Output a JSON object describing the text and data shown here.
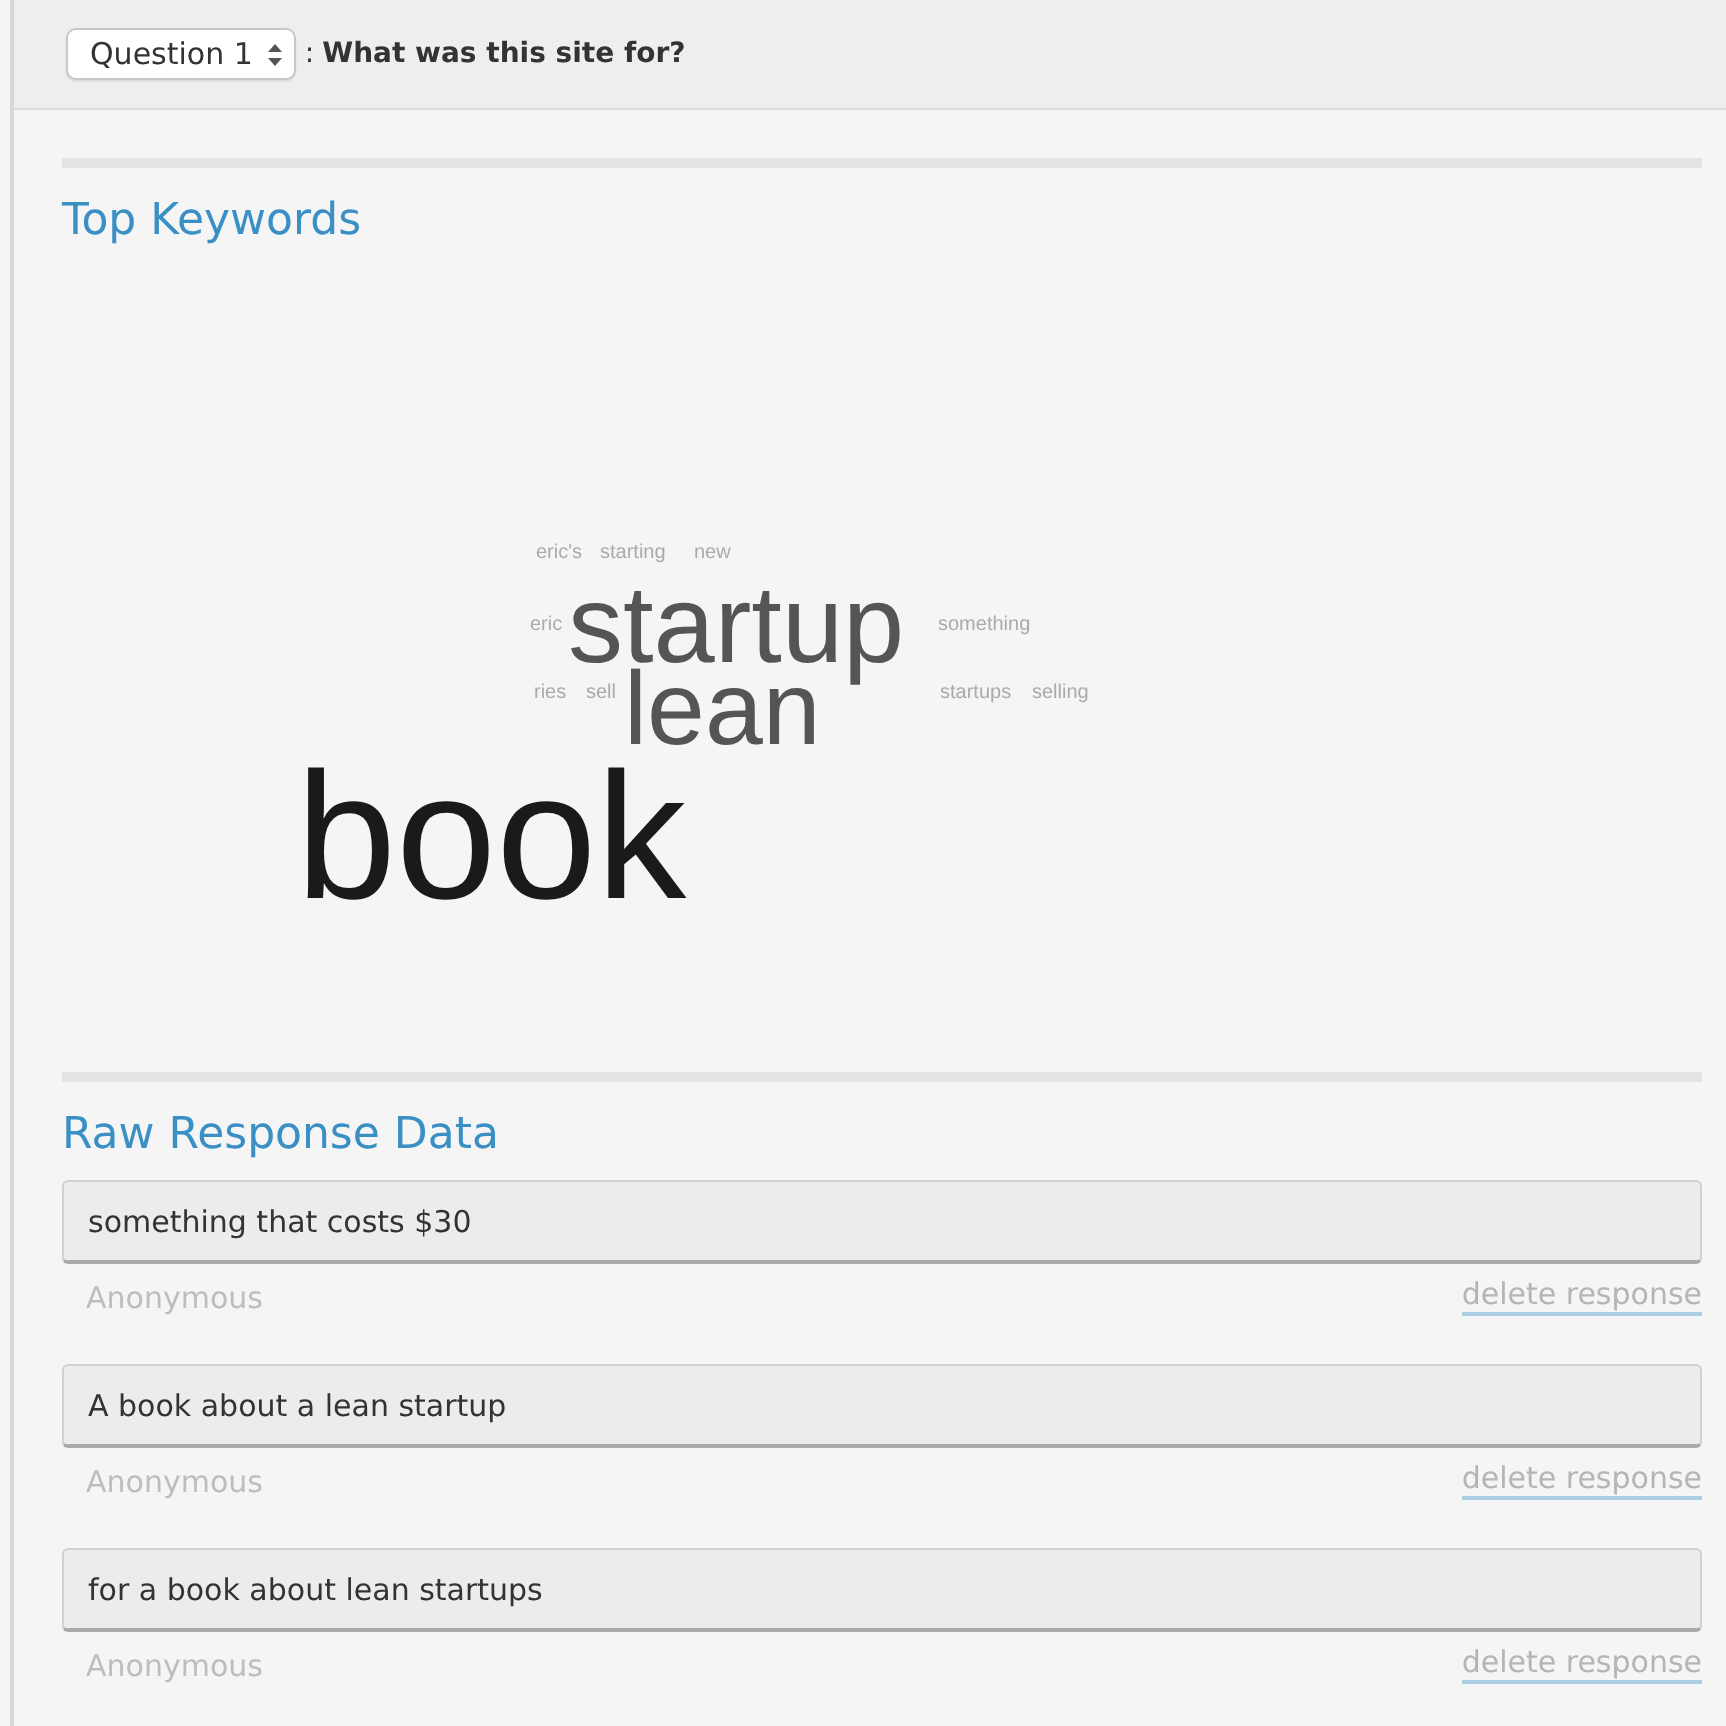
{
  "header": {
    "question_select": {
      "value": "Question 1"
    },
    "separator": ":",
    "question_text": "What was this site for?"
  },
  "keywords": {
    "title": "Top Keywords",
    "words": [
      {
        "text": "eric's"
      },
      {
        "text": "starting"
      },
      {
        "text": "new"
      },
      {
        "text": "eric"
      },
      {
        "text": "startup"
      },
      {
        "text": "something"
      },
      {
        "text": "ries"
      },
      {
        "text": "sell"
      },
      {
        "text": "lean"
      },
      {
        "text": "startups"
      },
      {
        "text": "selling"
      },
      {
        "text": "book"
      }
    ]
  },
  "responses": {
    "title": "Raw Response Data",
    "items": [
      {
        "text": "something that costs $30",
        "author": "Anonymous",
        "action": "delete response"
      },
      {
        "text": "A book about a lean startup",
        "author": "Anonymous",
        "action": "delete response"
      },
      {
        "text": "for a book about lean startups",
        "author": "Anonymous",
        "action": "delete response"
      }
    ]
  }
}
